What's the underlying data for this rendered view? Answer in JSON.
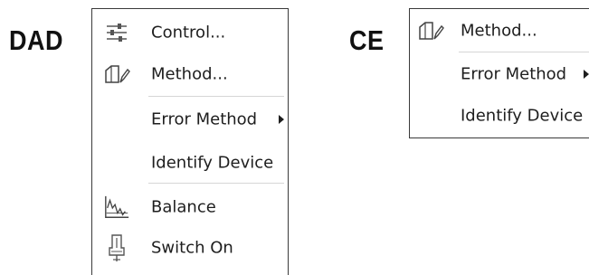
{
  "panels": {
    "dad": {
      "label": "DAD",
      "items": [
        {
          "label": "Control...",
          "icon": "sliders-icon"
        },
        {
          "label": "Method...",
          "icon": "method-edit-icon"
        },
        {
          "label": "Error Method",
          "submenu": true
        },
        {
          "label": "Identify Device"
        },
        {
          "label": "Balance",
          "icon": "balance-icon"
        },
        {
          "label": "Switch On",
          "icon": "lamp-icon"
        }
      ]
    },
    "ce": {
      "label": "CE",
      "items": [
        {
          "label": "Method...",
          "icon": "method-edit-icon"
        },
        {
          "label": "Error Method",
          "submenu": true
        },
        {
          "label": "Identify Device"
        }
      ]
    }
  },
  "colors": {
    "menu_border": "#3a3a3a",
    "text": "#1e1e1e",
    "separator": "#d6d6d6"
  }
}
